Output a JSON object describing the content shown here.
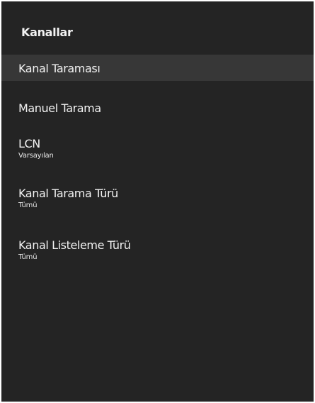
{
  "panel": {
    "title": "Kanallar"
  },
  "menu": {
    "selected_index": 0,
    "items": [
      {
        "label": "Kanal Taraması"
      },
      {
        "label": "Manuel Tarama"
      },
      {
        "label": "LCN",
        "value": "Varsayılan"
      },
      {
        "label": "Kanal Tarama Türü",
        "value": "Tümü"
      },
      {
        "label": "Kanal Listeleme Türü",
        "value": "Tümü"
      }
    ]
  },
  "colors": {
    "panel_background": "#242424",
    "selected_row_background": "#373737",
    "text": "#f2f2f2"
  }
}
